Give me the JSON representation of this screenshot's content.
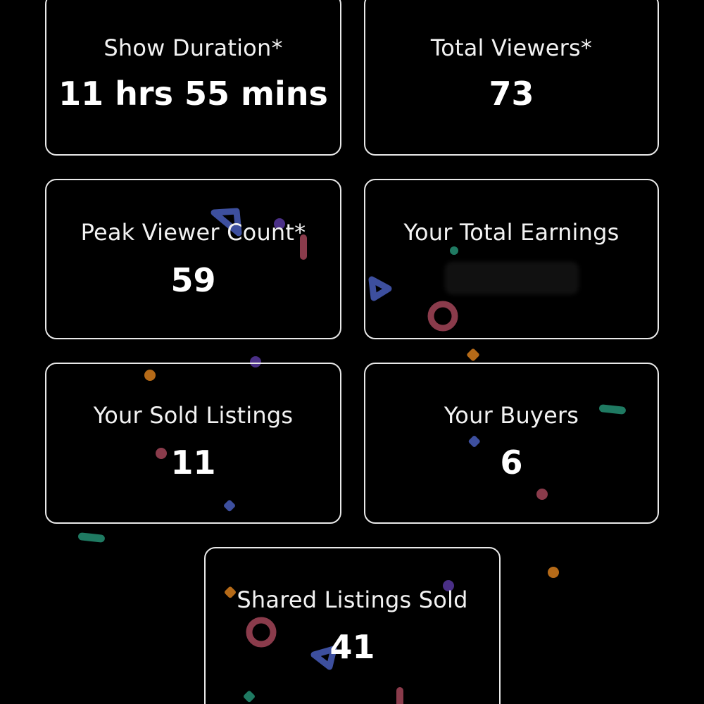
{
  "stats": [
    {
      "label": "Show Duration*",
      "value": "11 hrs 55 mins"
    },
    {
      "label": "Total Viewers*",
      "value": "73"
    },
    {
      "label": "Peak Viewer Count*",
      "value": "59"
    },
    {
      "label": "Your Total Earnings",
      "value": ""
    },
    {
      "label": "Your Sold Listings",
      "value": "11"
    },
    {
      "label": "Your Buyers",
      "value": "6"
    },
    {
      "label": "Shared Listings Sold",
      "value": "41"
    }
  ],
  "colors": {
    "background": "#000000",
    "card_border": "#e9e9e9",
    "text": "#ffffff",
    "confetti": [
      "#3d4f9e",
      "#8a3b4b",
      "#1f7a62",
      "#b56a18",
      "#4a2f86"
    ]
  }
}
